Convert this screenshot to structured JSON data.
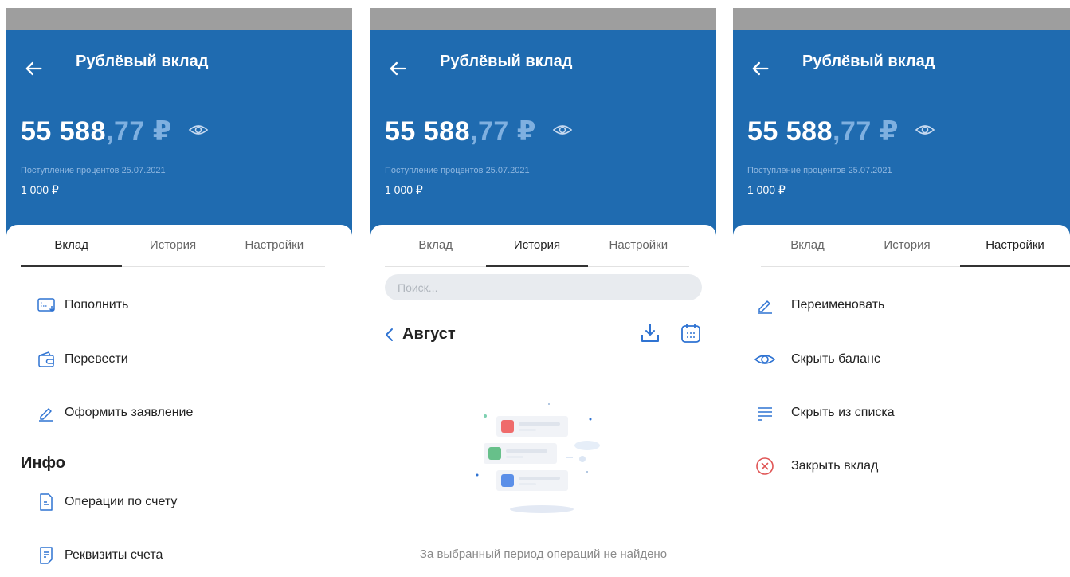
{
  "screen": {
    "title": "Рублёвый вклад",
    "balance_int": "55 588",
    "balance_dec": ",77 ₽",
    "interest_label": "Поступление процентов 25.07.2021",
    "interest_value": "1 000 ₽",
    "tabs": [
      "Вклад",
      "История",
      "Настройки"
    ]
  },
  "deposit_tab": {
    "actions": [
      {
        "label": "Пополнить",
        "icon": "card-deposit-icon"
      },
      {
        "label": "Перевести",
        "icon": "wallet-icon"
      },
      {
        "label": "Оформить заявление",
        "icon": "pencil-icon"
      }
    ],
    "info_title": "Инфо",
    "info_items": [
      {
        "label": "Операции по счету",
        "icon": "document-icon"
      },
      {
        "label": "Реквизиты счета",
        "icon": "requisites-icon"
      }
    ]
  },
  "history_tab": {
    "search_placeholder": "Поиск...",
    "month": "Август",
    "empty_text": "За выбранный период операций не найдено"
  },
  "settings_tab": {
    "items": [
      {
        "label": "Переименовать",
        "icon": "pencil-icon"
      },
      {
        "label": "Скрыть баланс",
        "icon": "eye-icon"
      },
      {
        "label": "Скрыть из списка",
        "icon": "list-icon"
      },
      {
        "label": "Закрыть вклад",
        "icon": "close-circle-icon"
      }
    ]
  },
  "colors": {
    "header_blue": "#1f6bb0",
    "accent_blue": "#2f73d2",
    "danger_red": "#e05555"
  }
}
